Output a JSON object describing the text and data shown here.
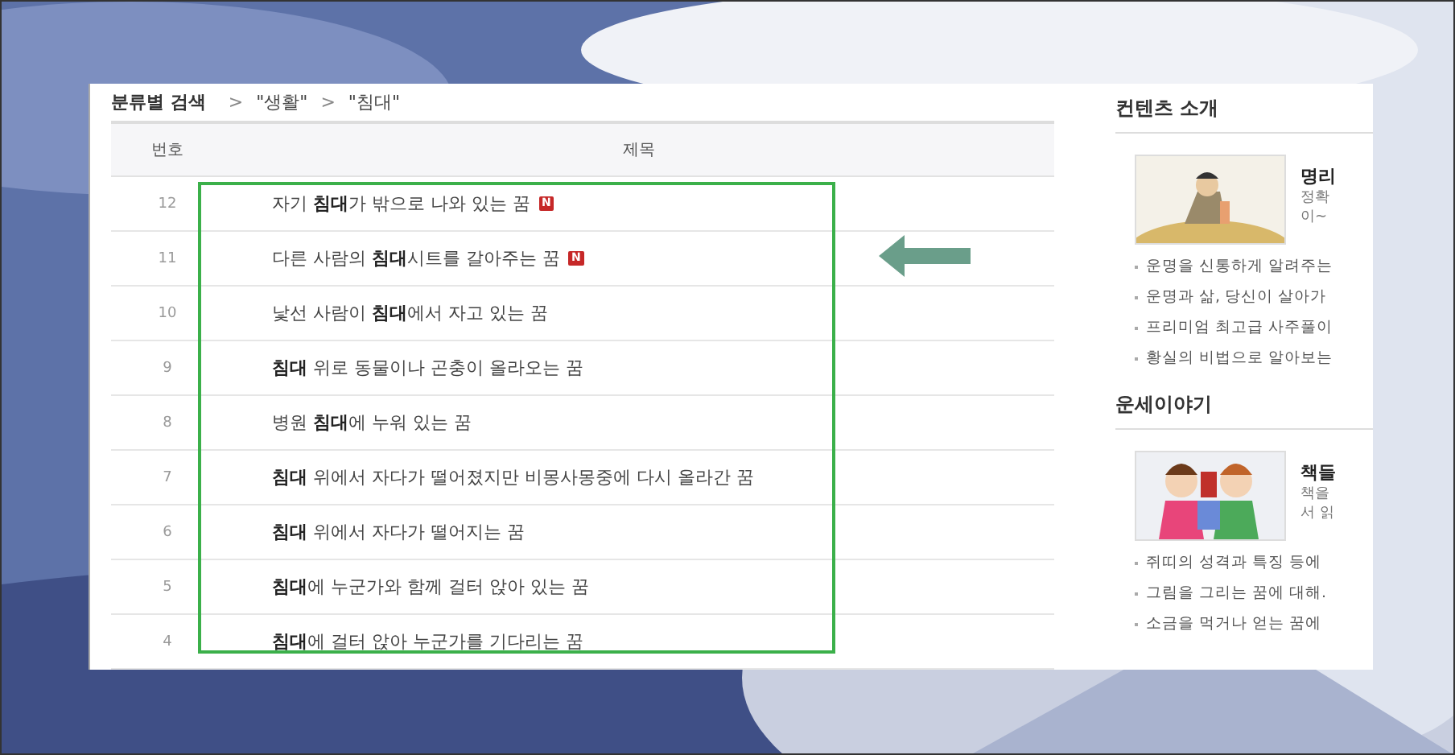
{
  "breadcrumb": {
    "title": "분류별 검색",
    "path": [
      {
        "sep": ">",
        "label": "\"생활\""
      },
      {
        "sep": ">",
        "label": "\"침대\""
      }
    ]
  },
  "table": {
    "columns": [
      "번호",
      "제목"
    ],
    "rows": [
      {
        "number": "12",
        "title": "자기 **침대**가 밖으로 나와 있는 꿈",
        "badge": "N"
      },
      {
        "number": "11",
        "title": "다른 사람의 **침대**시트를 갈아주는 꿈",
        "badge": "N"
      },
      {
        "number": "10",
        "title": "낯선 사람이 **침대**에서 자고 있는 꿈"
      },
      {
        "number": "9",
        "title": "**침대** 위로 동물이나 곤충이 올라오는 꿈"
      },
      {
        "number": "8",
        "title": "병원 **침대**에 누워 있는 꿈"
      },
      {
        "number": "7",
        "title": "**침대** 위에서 자다가 떨어졌지만 비몽사몽중에 다시 올라간 꿈"
      },
      {
        "number": "6",
        "title": "**침대** 위에서 자다가 떨어지는 꿈"
      },
      {
        "number": "5",
        "title": "**침대**에 누군가와 함께 걸터 앉아 있는 꿈"
      },
      {
        "number": "4",
        "title": "**침대**에 걸터 앉아 누군가를 기다리는 꿈"
      }
    ]
  },
  "sidebar": [
    {
      "heading": "컨텐츠 소개",
      "feature": {
        "kind": "picture",
        "title": "명리",
        "lines": [
          "정확",
          "이~"
        ]
      },
      "links": [
        "운명을 신통하게 알려주는",
        "운명과 삶, 당신이 살아가",
        "프리미엄 최고급 사주풀이",
        "황실의 비법으로 알아보는"
      ]
    },
    {
      "heading": "운세이야기",
      "feature": {
        "kind": "picture",
        "title": "책들",
        "lines": [
          "책을",
          "서 읽"
        ]
      },
      "links": [
        "쥐띠의 성격과 특징 등에",
        "그림을 그리는 꿈에 대해.",
        "소금을 먹거나 얻는 꿈에"
      ]
    }
  ]
}
